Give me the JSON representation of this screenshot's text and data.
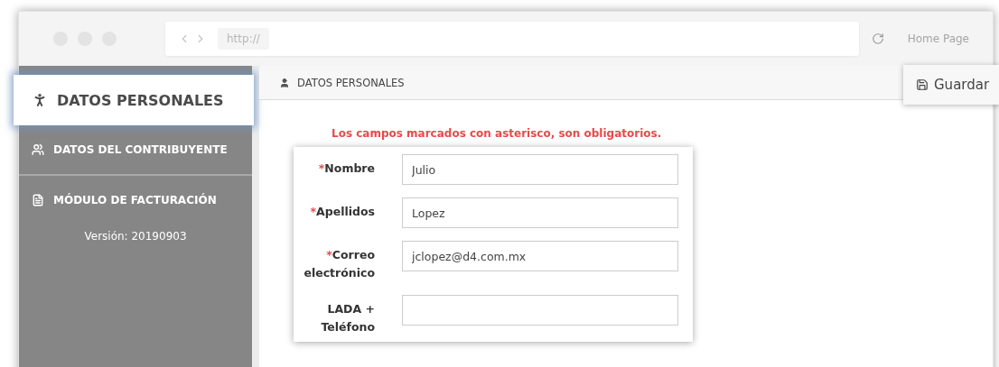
{
  "browser": {
    "url": "http://",
    "home": "Home Page"
  },
  "sidebar": {
    "items": [
      {
        "label": "DATOS PERSONALES",
        "kind": "person",
        "selected": true
      },
      {
        "label": "DATOS DEL CONTRIBUYENTE",
        "kind": "group",
        "selected": false
      },
      {
        "label": "MÓDULO DE FACTURACIÓN",
        "kind": "document",
        "selected": false
      }
    ],
    "version": "Versión: 20190903"
  },
  "header": {
    "title": "DATOS PERSONALES"
  },
  "save_button": "Guardar",
  "notice": "Los campos marcados con asterisco, son obligatorios.",
  "form": {
    "fields": [
      {
        "mark": "*",
        "label": "Nombre",
        "value": "Julio"
      },
      {
        "mark": "*",
        "label": "Apellidos",
        "value": "Lopez"
      },
      {
        "mark": "*",
        "label": "Correo electrónico",
        "value": "jclopez@d4.com.mx"
      },
      {
        "label": "LADA + Teléfono"
      }
    ]
  }
}
